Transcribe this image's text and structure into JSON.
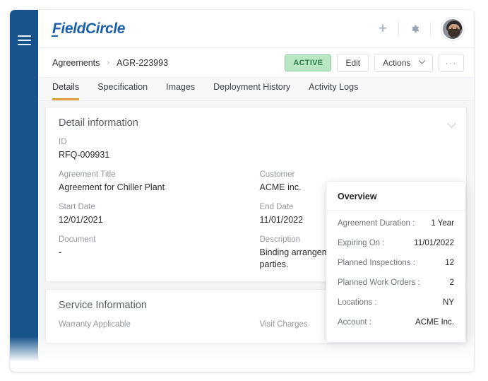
{
  "app": {
    "logo_text": "FieldCircle"
  },
  "topbar": {
    "add_icon": "plus-icon",
    "settings_icon": "gear-icon",
    "avatar": "user-avatar"
  },
  "breadcrumb": {
    "parent": "Agreements",
    "separator": "›",
    "current": "AGR-223993"
  },
  "actions": {
    "status": "ACTIVE",
    "edit": "Edit",
    "actions": "Actions",
    "more": "···"
  },
  "tabs": [
    {
      "label": "Details",
      "active": true
    },
    {
      "label": "Specification",
      "active": false
    },
    {
      "label": "Images",
      "active": false
    },
    {
      "label": "Deployment History",
      "active": false
    },
    {
      "label": "Activity Logs",
      "active": false
    }
  ],
  "detail_card": {
    "title": "Detail information",
    "fields": [
      {
        "label": "ID",
        "value": "RFQ-009931"
      },
      {
        "label": "Agreement Title",
        "value": "Agreement for Chiller Plant"
      },
      {
        "label": "Customer",
        "value": "ACME inc."
      },
      {
        "label": "Start Date",
        "value": "12/01/2021"
      },
      {
        "label": "End Date",
        "value": "11/01/2022"
      },
      {
        "label": "Document",
        "value": "-"
      },
      {
        "label": "Description",
        "value": "Binding arrangement between two or more parties."
      }
    ]
  },
  "service_card": {
    "title": "Service Information",
    "fields": [
      {
        "label": "Warranty Applicable"
      },
      {
        "label": "Visit Charges"
      }
    ]
  },
  "overview": {
    "title": "Overview",
    "rows": [
      {
        "key": "Agreement Duration :",
        "value": "1 Year"
      },
      {
        "key": "Expiring On :",
        "value": "11/01/2022"
      },
      {
        "key": "Planned Inspections :",
        "value": "12"
      },
      {
        "key": "Planned Work Orders :",
        "value": "2"
      },
      {
        "key": "Locations :",
        "value": "NY"
      },
      {
        "key": "Account :",
        "value": "ACME Inc."
      }
    ]
  },
  "colors": {
    "sidebar": "#17548c",
    "brand": "#1b5fab",
    "accent": "#e59a3a",
    "status_bg": "#b9e7c4",
    "status_text": "#2f7d4d",
    "page_bg": "#f4f5f7"
  }
}
